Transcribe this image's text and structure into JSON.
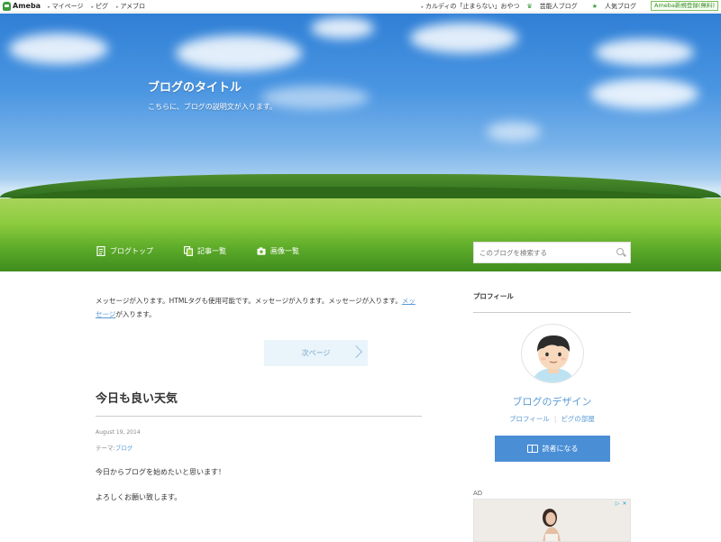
{
  "topbar": {
    "brand": "Ameba",
    "links": [
      "マイページ",
      "ピグ",
      "アメブロ"
    ],
    "right_links": [
      "カルディの「止まらない」おやつ",
      "芸能人ブログ",
      "人気ブログ"
    ],
    "register": "Ameba新規登録(無料)"
  },
  "header": {
    "title": "ブログのタイトル",
    "description": "こちらに、ブログの説明文が入ります。",
    "nav": [
      "ブログトップ",
      "記事一覧",
      "画像一覧"
    ],
    "search_placeholder": "このブログを検索する"
  },
  "main": {
    "message_text": "メッセージが入ります。HTMLタグも使用可能です。メッセージが入ります。メッセージが入ります。",
    "message_link": "メッセージ",
    "message_tail": "が入ります。",
    "next_label": "次ページ",
    "entry": {
      "title": "今日も良い天気",
      "date": "August 19, 2014",
      "theme_label": "テーマ:",
      "theme": "ブログ",
      "body": [
        "今日からブログを始めたいと思います！",
        "よろしくお願い致します。"
      ]
    }
  },
  "sidebar": {
    "heading": "プロフィール",
    "name": "ブログのデザイン",
    "links": [
      "プロフィール",
      "ピグの部屋"
    ],
    "follow": "読者になる",
    "ad_label": "AD"
  }
}
